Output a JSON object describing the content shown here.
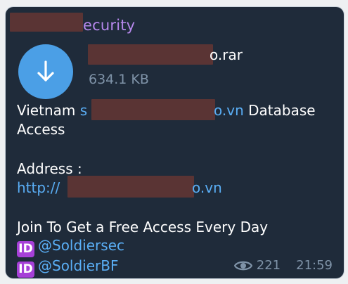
{
  "message": {
    "sender_visible": "ecurity",
    "file": {
      "name_visible": "o.rar",
      "size": "634.1 KB",
      "action_icon": "download-arrow-icon"
    },
    "body": {
      "line1_prefix": "Vietnam ",
      "line1_link_start": "s",
      "line1_link_end": "o.vn",
      "line1_suffix": " Database",
      "line2": "Access",
      "address_label": "Address :",
      "address_link_start": "http://",
      "address_link_end": "o.vn",
      "join_text": "Join To Get a Free Access Every Day",
      "handles": [
        {
          "badge": "ID",
          "handle": "@Soldiersec"
        },
        {
          "badge": "ID",
          "handle": "@SoldierBF"
        }
      ]
    },
    "views": "221",
    "time": "21:59",
    "views_icon": "eye-icon"
  },
  "colors": {
    "bubble_bg": "#1f2b3a",
    "sender": "#b688ec",
    "link": "#5aaef5",
    "meta": "#7f93a8",
    "download_button": "#4b9fe6",
    "id_badge": "#a640d8",
    "redaction": "#5a3434"
  }
}
